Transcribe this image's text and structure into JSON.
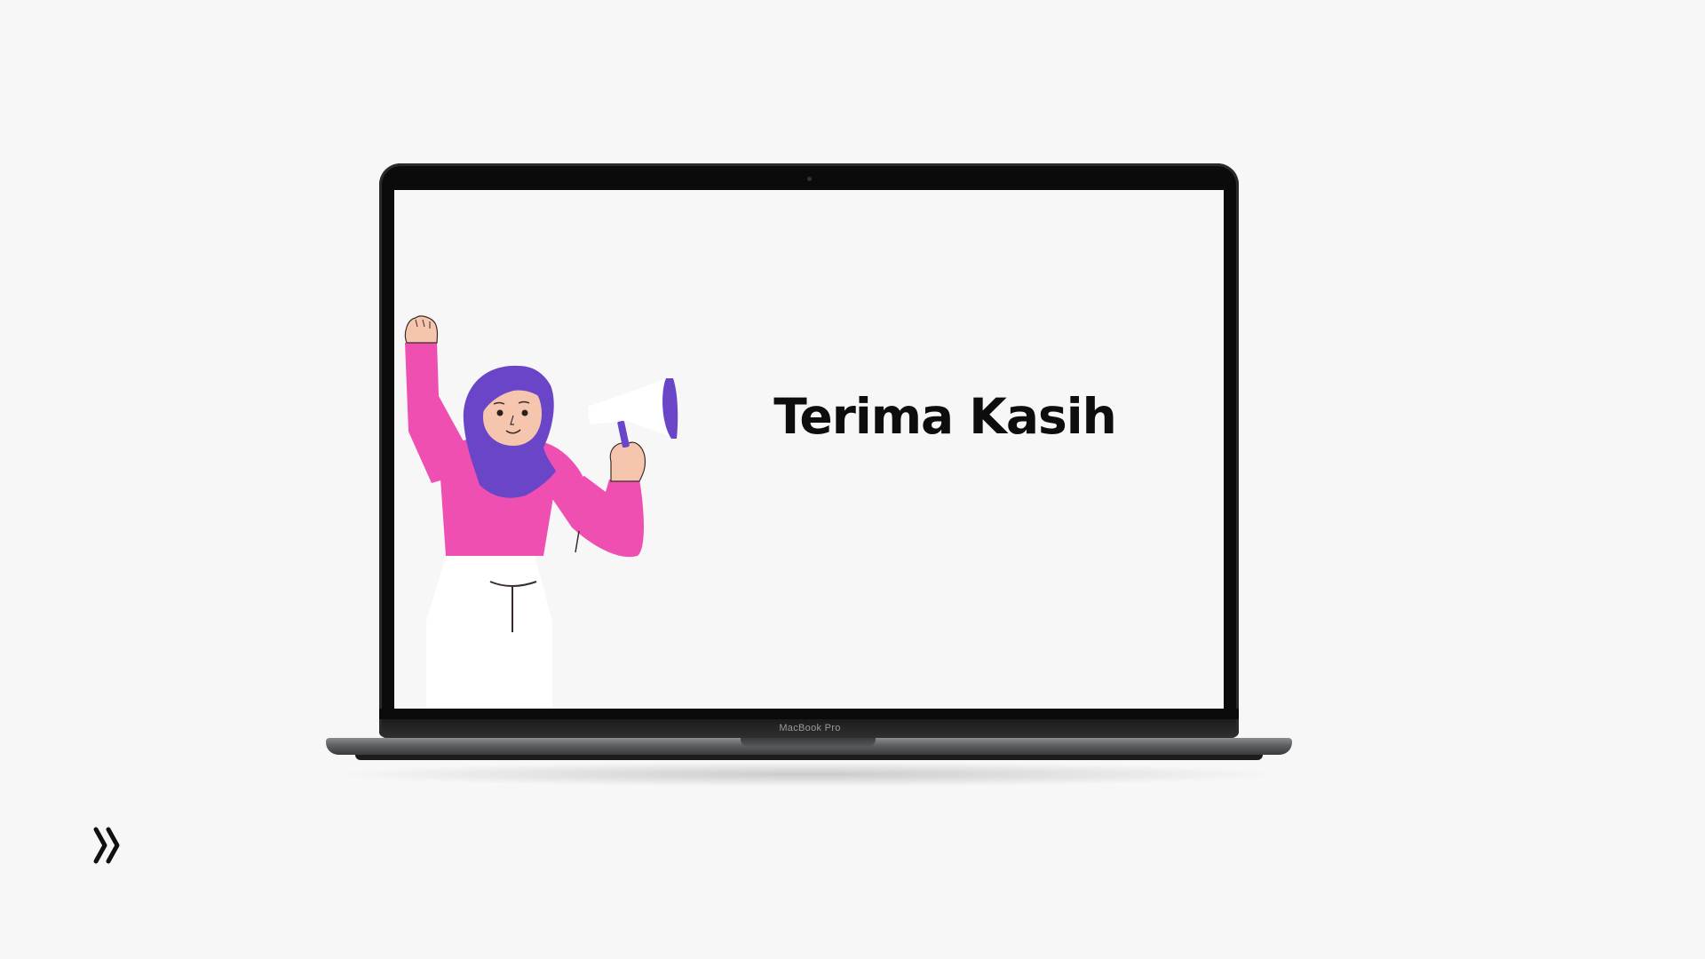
{
  "slide": {
    "title": "Terima Kasih"
  },
  "device": {
    "brand_label": "MacBook Pro"
  },
  "navigation": {
    "next_icon": "double-chevron-right-icon"
  },
  "illustration": {
    "subject": "woman-with-megaphone-illustration"
  },
  "colors": {
    "background": "#f7f7f7",
    "hijab": "#6a45c8",
    "shirt": "#f04fb2",
    "skin": "#f6c5ad",
    "pants": "#ffffff",
    "title_text": "#0d0d0d"
  }
}
